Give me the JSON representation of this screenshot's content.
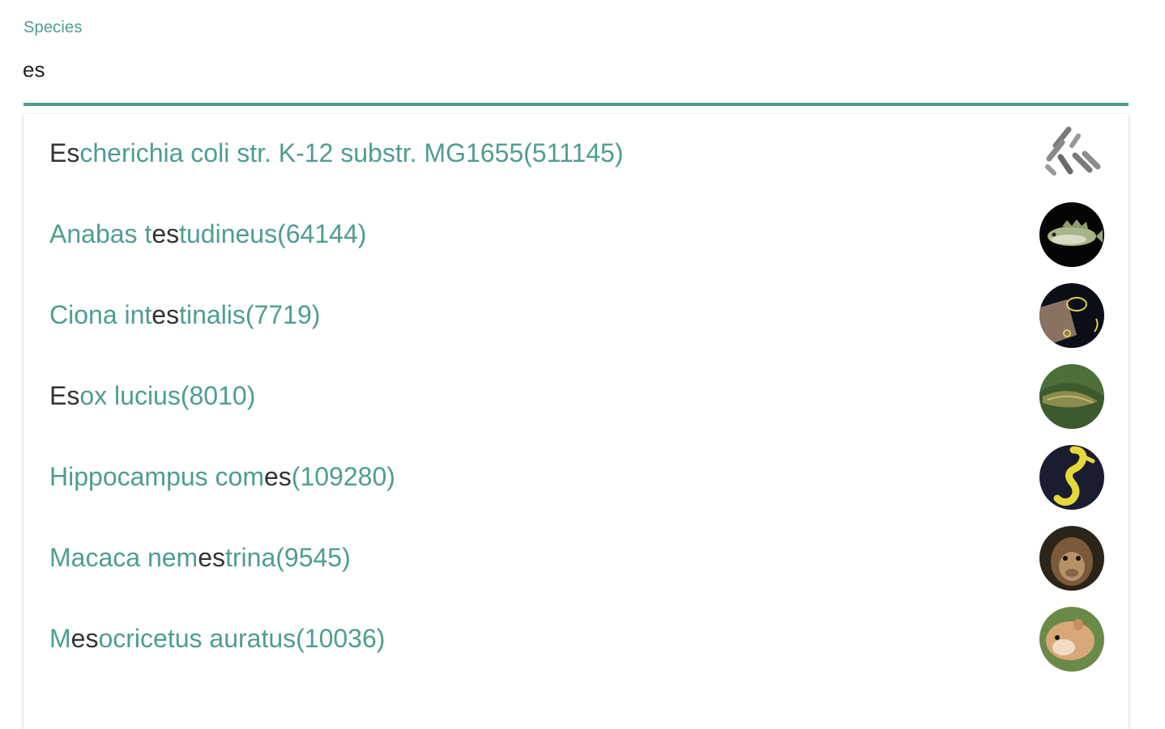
{
  "field": {
    "label": "Species",
    "value": "es",
    "accent_color": "#4e9d93"
  },
  "options": [
    {
      "pre": "",
      "match": "Es",
      "post": "cherichia coli str. K-12 substr. MG1655(511145)",
      "icon": "bacteria-icon"
    },
    {
      "pre": "Anabas t",
      "match": "es",
      "post": "tudineus(64144)",
      "icon": "fish-icon"
    },
    {
      "pre": "Ciona int",
      "match": "es",
      "post": "tinalis(7719)",
      "icon": "sea-squirt-icon"
    },
    {
      "pre": "",
      "match": "Es",
      "post": "ox lucius(8010)",
      "icon": "pike-icon"
    },
    {
      "pre": "Hippocampus com",
      "match": "es",
      "post": "(109280)",
      "icon": "seahorse-icon"
    },
    {
      "pre": "Macaca nem",
      "match": "es",
      "post": "trina(9545)",
      "icon": "macaque-icon"
    },
    {
      "pre": "M",
      "match": "es",
      "post": "ocricetus auratus(10036)",
      "icon": "hamster-icon"
    }
  ],
  "colors": {
    "match_text": "#333333",
    "option_text": "#4e9d93"
  }
}
